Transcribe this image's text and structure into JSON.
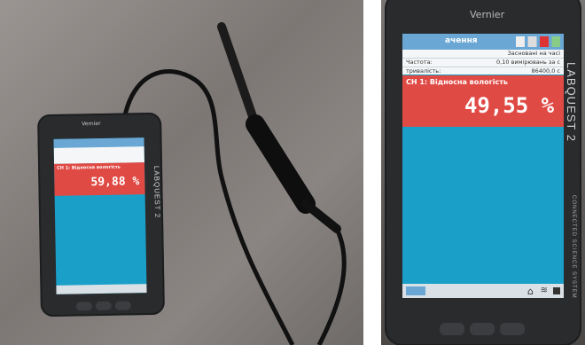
{
  "left_device": {
    "brand": "LABQUEST 2",
    "maker": "Vernier",
    "channel_label": "CH 1: Відносна вологість",
    "reading": "59,88 %"
  },
  "right_device": {
    "maker": "Vernier",
    "brand": "LABQUEST 2",
    "side_text": "CONNECTED SCIENCE SYSTEM",
    "title_fragment": "ачення",
    "info_rows": [
      {
        "label": "",
        "value": "Засновані на часі"
      },
      {
        "label": "Частота:",
        "value": "0,10 вимірювань за с"
      },
      {
        "label": "тривалість:",
        "value": "86400,0 с"
      }
    ],
    "channel_label": "CH 1: Відносна вологість",
    "reading": "49,55 %"
  },
  "colors": {
    "screen": "#1aa0c8",
    "channel": "#e04a45",
    "titlebar": "#6aa7d4"
  }
}
